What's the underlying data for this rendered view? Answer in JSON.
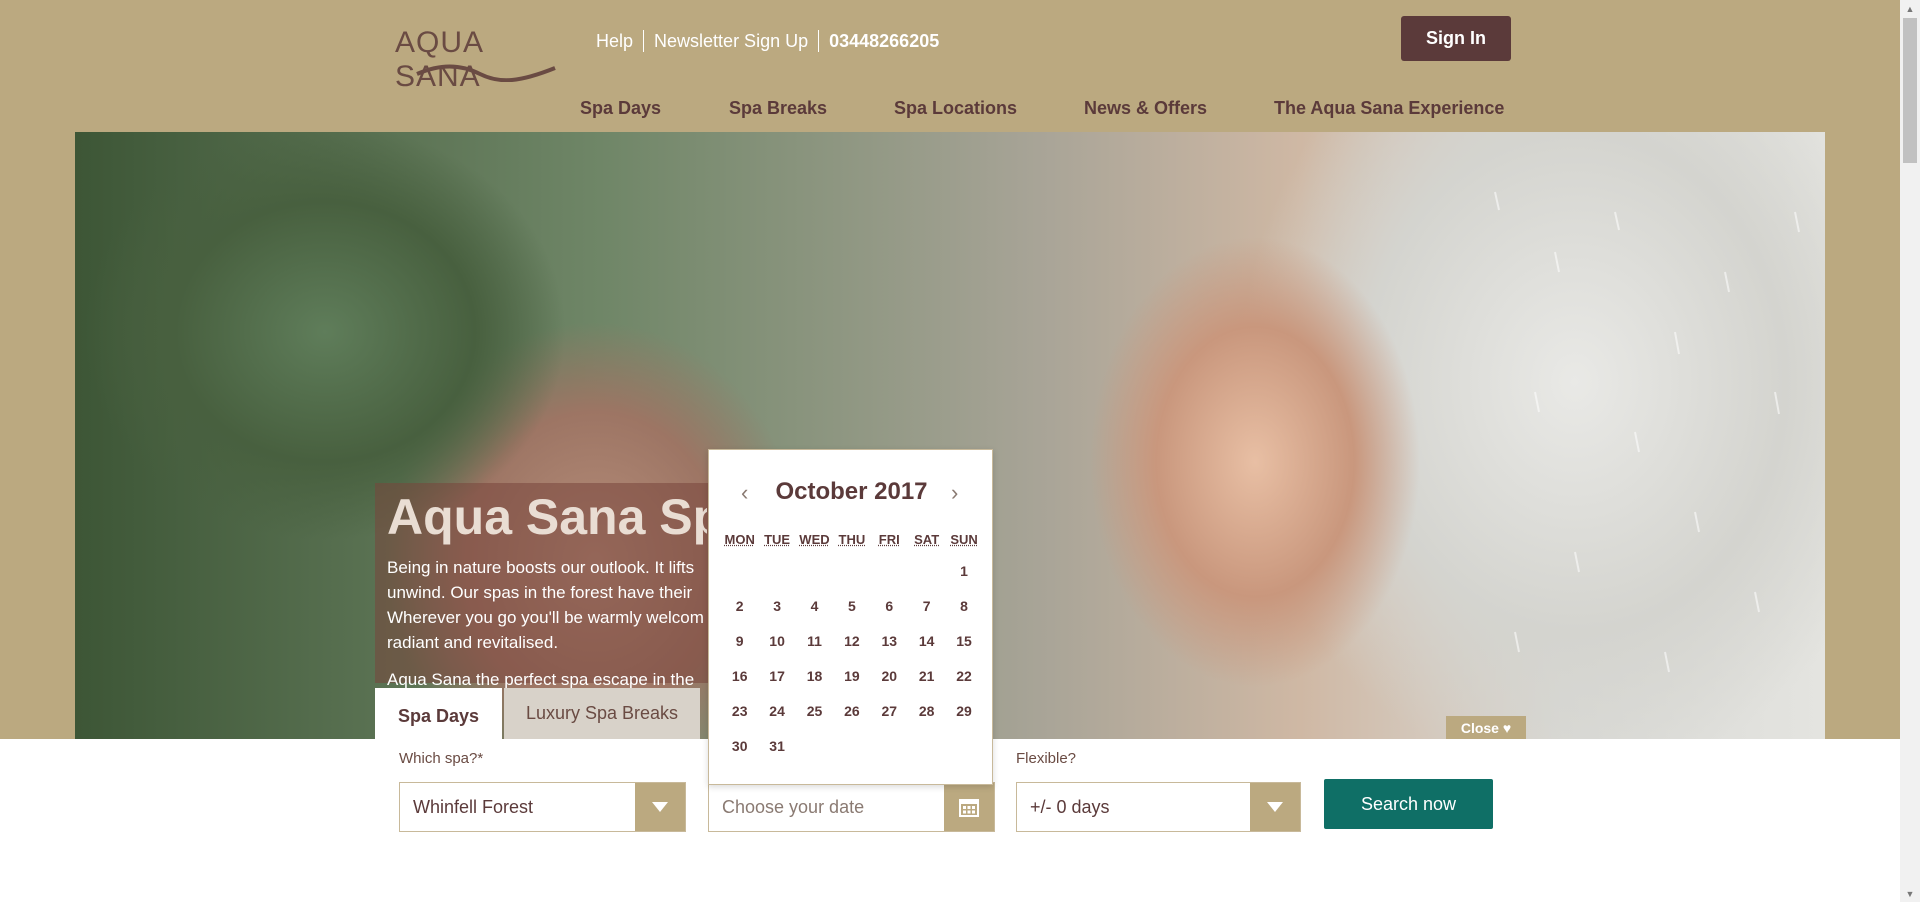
{
  "header": {
    "logo_text": "AQUA SANA",
    "links": [
      "Help",
      "Newsletter Sign Up",
      "03448266205"
    ],
    "sign_in": "Sign In"
  },
  "nav": [
    "Spa Days",
    "Spa Breaks",
    "Spa Locations",
    "News & Offers",
    "The Aqua Sana Experience"
  ],
  "hero": {
    "title": "Aqua Sana Sp",
    "paragraph1": "Being in nature boosts our outlook. It lifts unwind. Our spas in the forest have their Wherever you go you'll be warmly welcom radiant and revitalised.",
    "paragraph2": "Aqua Sana the perfect spa escape in the"
  },
  "tabs": [
    "Spa Days",
    "Luxury Spa Breaks"
  ],
  "close_label": "Close ♥",
  "search": {
    "spa_label": "Which spa?*",
    "spa_value": "Whinfell Forest",
    "date_placeholder": "Choose your date",
    "flexible_label": "Flexible?",
    "flexible_value": "+/- 0 days",
    "button": "Search now"
  },
  "calendar": {
    "month_title": "October 2017",
    "prev": "‹",
    "next": "›",
    "days_of_week": [
      "MON",
      "TUE",
      "WED",
      "THU",
      "FRI",
      "SAT",
      "SUN"
    ],
    "weeks": [
      [
        "",
        "",
        "",
        "",
        "",
        "",
        "1"
      ],
      [
        "2",
        "3",
        "4",
        "5",
        "6",
        "7",
        "8"
      ],
      [
        "9",
        "10",
        "11",
        "12",
        "13",
        "14",
        "15"
      ],
      [
        "16",
        "17",
        "18",
        "19",
        "20",
        "21",
        "22"
      ],
      [
        "23",
        "24",
        "25",
        "26",
        "27",
        "28",
        "29"
      ],
      [
        "30",
        "31",
        "",
        "",
        "",
        "",
        ""
      ]
    ]
  },
  "colors": {
    "header_bg": "#bba980",
    "brand_dark": "#5b3a3a",
    "search_button": "#0f6f66"
  }
}
